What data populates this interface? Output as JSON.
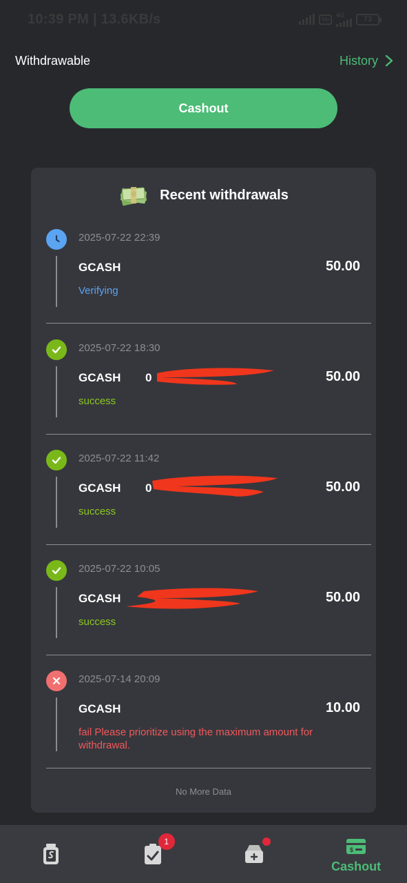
{
  "status_bar": {
    "time": "10:39 PM | 13.6KB/s",
    "network": "4G",
    "volte": "Vo",
    "battery": "73"
  },
  "header": {
    "title": "Withdrawable",
    "history_label": "History"
  },
  "cashout_button": {
    "label": "Cashout"
  },
  "recent": {
    "title": "Recent withdrawals",
    "entries": [
      {
        "date": "2025-07-22 22:39",
        "method": "GCASH",
        "account": "",
        "amount": "50.00",
        "status": "Verifying",
        "state": "verifying"
      },
      {
        "date": "2025-07-22 18:30",
        "method": "GCASH",
        "account": "0",
        "amount": "50.00",
        "status": "success",
        "state": "success"
      },
      {
        "date": "2025-07-22 11:42",
        "method": "GCASH",
        "account": "0",
        "amount": "50.00",
        "status": "success",
        "state": "success"
      },
      {
        "date": "2025-07-22 10:05",
        "method": "GCASH",
        "account": "",
        "amount": "50.00",
        "status": "success",
        "state": "success"
      },
      {
        "date": "2025-07-14 20:09",
        "method": "GCASH",
        "account": "",
        "amount": "10.00",
        "status": "fail Please prioritize using the maximum amount for withdrawal.",
        "state": "fail"
      }
    ],
    "footer": "No More Data"
  },
  "bottom_nav": {
    "items": [
      {
        "icon": "wallet-jar-icon",
        "label": ""
      },
      {
        "icon": "task-clipboard-icon",
        "label": "",
        "badge": "1"
      },
      {
        "icon": "inbox-add-icon",
        "label": ""
      },
      {
        "icon": "cashout-card-icon",
        "label": "Cashout"
      }
    ]
  },
  "colors": {
    "background": "#27282c",
    "card": "#36373d",
    "accent": "#4cbc77",
    "verifying": "#5aa4f2",
    "success": "#8cc81e",
    "fail": "#f0595a"
  }
}
